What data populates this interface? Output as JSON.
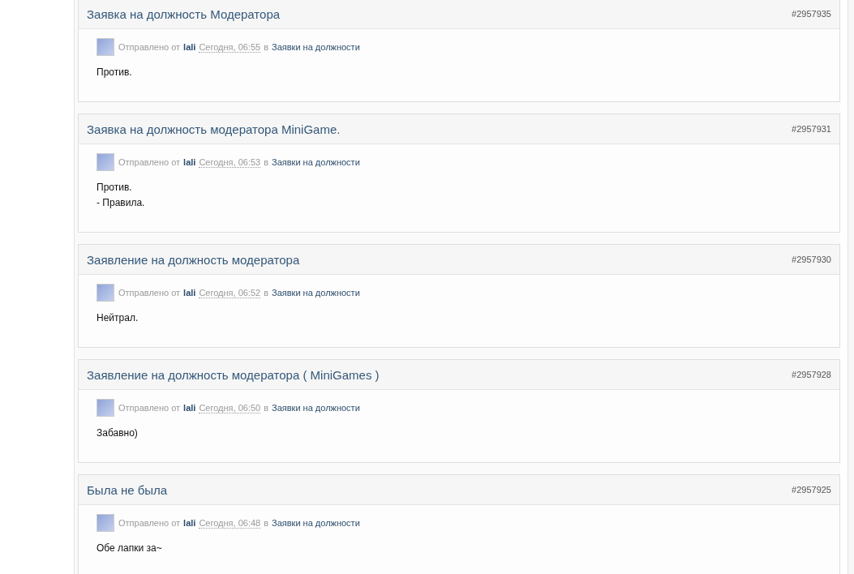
{
  "posts": [
    {
      "title": "Заявка на должность Модератора",
      "post_id": "#2957935",
      "meta": {
        "prefix": "Отправлено от",
        "author": "lali",
        "date": "Сегодня, 06:55",
        "in": "в",
        "forum": "Заявки на должности"
      },
      "body": [
        "Против."
      ]
    },
    {
      "title": "Заявка на должность модератора MiniGame.",
      "post_id": "#2957931",
      "meta": {
        "prefix": "Отправлено от",
        "author": "lali",
        "date": "Сегодня, 06:53",
        "in": "в",
        "forum": "Заявки на должности"
      },
      "body": [
        "Против.",
        "- Правила."
      ]
    },
    {
      "title": "Заявление на должность модератора",
      "post_id": "#2957930",
      "meta": {
        "prefix": "Отправлено от",
        "author": "lali",
        "date": "Сегодня, 06:52",
        "in": "в",
        "forum": "Заявки на должности"
      },
      "body": [
        "Нейтрал."
      ]
    },
    {
      "title": "Заявление на должность модератора ( MiniGames )",
      "post_id": "#2957928",
      "meta": {
        "prefix": "Отправлено от",
        "author": "lali",
        "date": "Сегодня, 06:50",
        "in": "в",
        "forum": "Заявки на должности"
      },
      "body": [
        "Забавно)"
      ]
    },
    {
      "title": "Была не была",
      "post_id": "#2957925",
      "meta": {
        "prefix": "Отправлено от",
        "author": "lali",
        "date": "Сегодня, 06:48",
        "in": "в",
        "forum": "Заявки на должности"
      },
      "body": [
        "Обе лапки за~"
      ]
    }
  ]
}
